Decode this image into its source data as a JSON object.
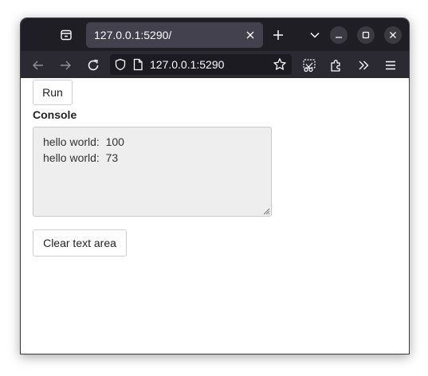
{
  "browser": {
    "tab": {
      "title": "127.0.0.1:5290/"
    },
    "urlbar": {
      "url": "127.0.0.1:5290"
    },
    "icons": {
      "tabs_list": "tab-list-icon",
      "tab_close": "close-icon",
      "new_tab": "plus-icon",
      "all_tabs": "chevron-down-icon",
      "minimize": "minimize-icon",
      "maximize": "maximize-icon",
      "close_window": "close-icon",
      "back": "arrow-left-icon",
      "forward": "arrow-right-icon",
      "reload": "reload-icon",
      "site_info": "shield-icon",
      "page": "page-icon",
      "bookmark": "star-icon",
      "screenshot": "scissors-icon",
      "extensions": "puzzle-icon",
      "overflow": "double-chevron-icon",
      "menu": "hamburger-icon"
    },
    "colors": {
      "titlebar": "#1f1e25",
      "tab_active": "#42414d",
      "toolbar": "#2b2a33",
      "urlbar": "#1c1b22",
      "toolbar_text": "#fbfbfe"
    }
  },
  "page": {
    "run_button_label": "Run",
    "console_label": "Console",
    "console_lines": [
      "hello world:  100",
      "hello world:  73"
    ],
    "clear_button_label": "Clear text area"
  }
}
